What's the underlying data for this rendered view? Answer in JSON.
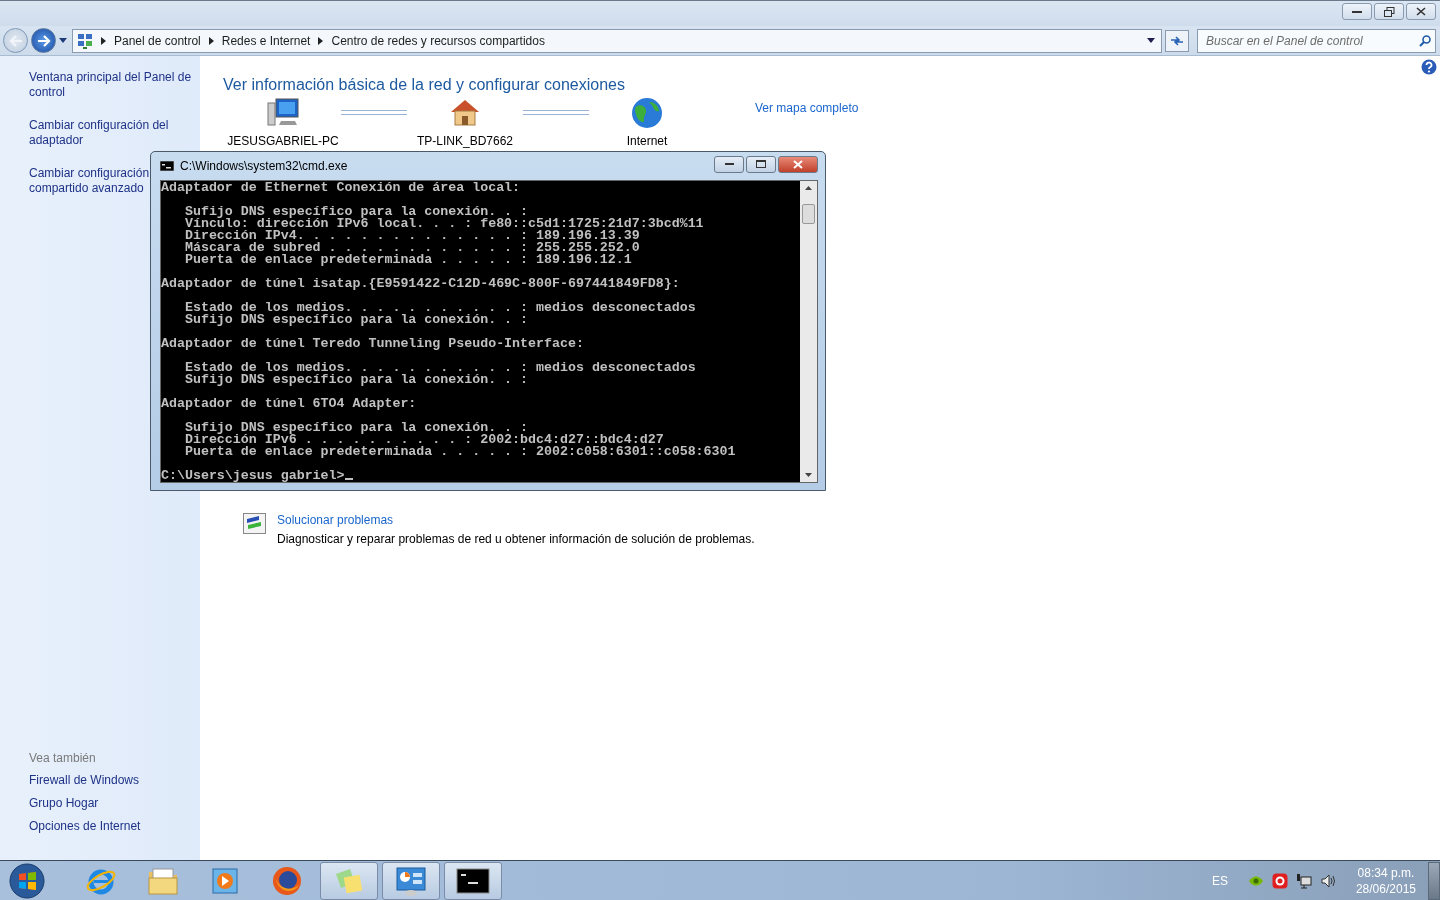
{
  "address_bar": {
    "breadcrumbs": [
      "Panel de control",
      "Redes e Internet",
      "Centro de redes y recursos compartidos"
    ]
  },
  "search": {
    "placeholder": "Buscar en el Panel de control"
  },
  "sidebar": {
    "links": [
      "Ventana principal del Panel de control",
      "Cambiar configuración del adaptador",
      "Cambiar configuración compartido avanzado"
    ],
    "see_also": {
      "heading": "Vea también",
      "links": [
        "Firewall de Windows",
        "Grupo Hogar",
        "Opciones de Internet"
      ]
    }
  },
  "main": {
    "title": "Ver información básica de la red y configurar conexiones",
    "map_link": "Ver mapa completo",
    "network_map": [
      {
        "kind": "computer",
        "label": "JESUSGABRIEL-PC"
      },
      {
        "kind": "router",
        "label": "TP-LINK_BD7662"
      },
      {
        "kind": "globe",
        "label": "Internet"
      }
    ],
    "tasks": [
      {
        "title": "Solucionar problemas",
        "description": "Diagnosticar y reparar problemas de red u obtener información de solución de problemas."
      }
    ]
  },
  "console_window": {
    "title": "C:\\Windows\\system32\\cmd.exe",
    "sections": [
      {
        "heading": "Adaptador de Ethernet Conexión de área local:",
        "lines": [
          "   Sufijo DNS específico para la conexión. . :",
          "   Vínculo: dirección IPv6 local. . . : fe80::c5d1:1725:21d7:3bcd%11",
          "   Dirección IPv4. . . . . . . . . . . . . . : 189.196.13.39",
          "   Máscara de subred . . . . . . . . . . . . : 255.255.252.0",
          "   Puerta de enlace predeterminada . . . . . : 189.196.12.1"
        ]
      },
      {
        "heading": "Adaptador de túnel isatap.{E9591422-C12D-469C-800F-697441849FD8}:",
        "lines": [
          "   Estado de los medios. . . . . . . . . . . : medios desconectados",
          "   Sufijo DNS específico para la conexión. . :"
        ]
      },
      {
        "heading": "Adaptador de túnel Teredo Tunneling Pseudo-Interface:",
        "lines": [
          "   Estado de los medios. . . . . . . . . . . : medios desconectados",
          "   Sufijo DNS específico para la conexión. . :"
        ]
      },
      {
        "heading": "Adaptador de túnel 6TO4 Adapter:",
        "lines": [
          "   Sufijo DNS específico para la conexión. . :",
          "   Dirección IPv6 . . . . . . . . . . : 2002:bdc4:d27::bdc4:d27",
          "   Puerta de enlace predeterminada . . . . . : 2002:c058:6301::c058:6301"
        ]
      }
    ],
    "prompt": "C:\\Users\\jesus gabriel>"
  },
  "taskbar": {
    "items": [
      {
        "kind": "ie",
        "open": false
      },
      {
        "kind": "explorer",
        "open": false
      },
      {
        "kind": "media",
        "open": false
      },
      {
        "kind": "firefox",
        "open": false
      },
      {
        "kind": "notes",
        "open": true
      },
      {
        "kind": "panel",
        "open": true
      },
      {
        "kind": "cmd",
        "open": true
      }
    ],
    "language": "ES",
    "clock": {
      "time": "08:34 p.m.",
      "date": "28/06/2015"
    }
  }
}
